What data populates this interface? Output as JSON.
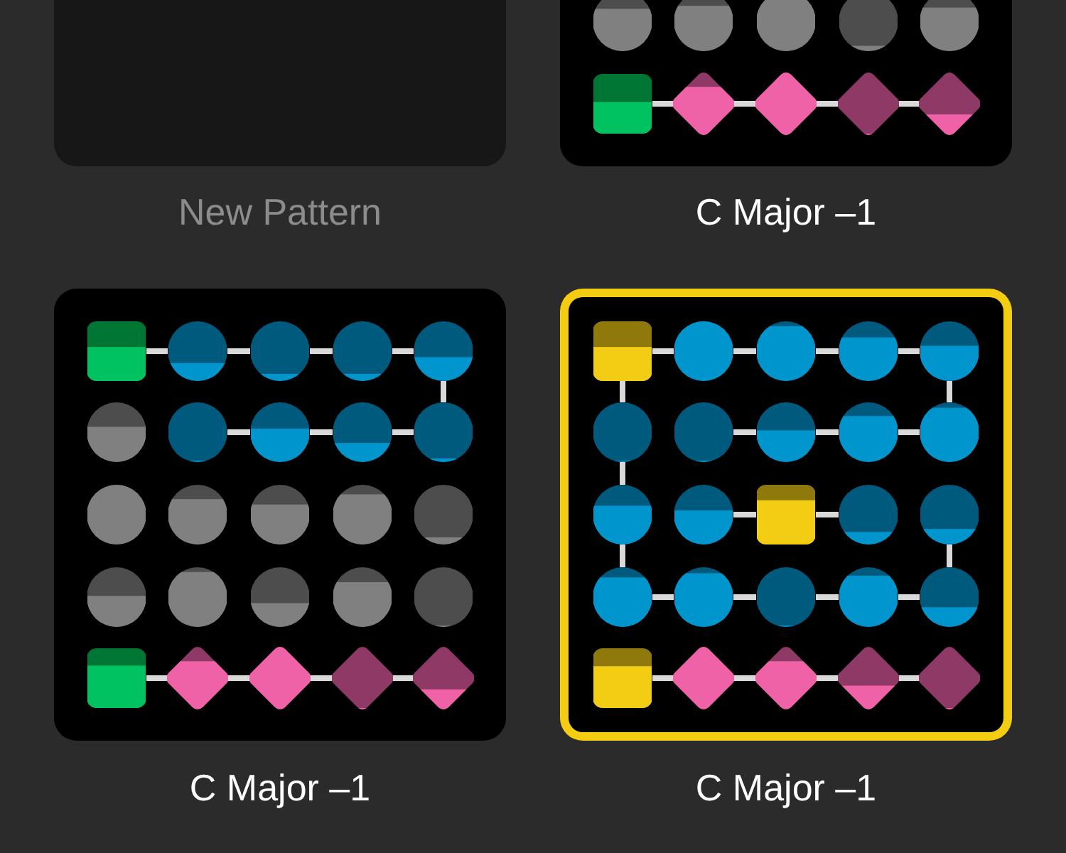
{
  "patterns": [
    {
      "kind": "new",
      "title": "New Pattern",
      "selected": false
    },
    {
      "kind": "pattern",
      "title": "C Major –1",
      "selected": false,
      "rows": [
        {
          "nodes": [
            {
              "kind": "circle",
              "active": false,
              "level": 0.71,
              "link_right": false,
              "link_down": false
            },
            {
              "kind": "circle",
              "active": false,
              "level": 0.76,
              "link_right": false,
              "link_down": false
            },
            {
              "kind": "circle",
              "active": false,
              "level": 0.86,
              "link_right": false,
              "link_down": false
            },
            {
              "kind": "circle",
              "active": false,
              "level": 0.09,
              "link_right": false,
              "link_down": false
            },
            {
              "kind": "circle",
              "active": false,
              "level": 0.73,
              "link_right": false,
              "link_down": false
            }
          ]
        },
        {
          "nodes": [
            {
              "kind": "square",
              "level": 0.53,
              "link_right": true,
              "link_down": false
            },
            {
              "kind": "diamond",
              "level": 0.77,
              "link_right": true,
              "link_down": false
            },
            {
              "kind": "diamond",
              "level": 1,
              "link_right": true,
              "link_down": false
            },
            {
              "kind": "diamond",
              "level": 0,
              "link_right": true,
              "link_down": false
            },
            {
              "kind": "diamond",
              "level": 0.33,
              "link_right": false,
              "link_down": false
            }
          ]
        }
      ]
    },
    {
      "kind": "pattern",
      "title": "C Major –1",
      "selected": false,
      "rows": [
        {
          "nodes": [
            {
              "kind": "square",
              "level": 0.57,
              "link_right": true,
              "link_down": false
            },
            {
              "kind": "circle",
              "active": true,
              "level": 0.3,
              "link_right": true,
              "link_down": false
            },
            {
              "kind": "circle",
              "active": true,
              "level": 0.12,
              "link_right": true,
              "link_down": false
            },
            {
              "kind": "circle",
              "active": true,
              "level": 0.12,
              "link_right": true,
              "link_down": false
            },
            {
              "kind": "circle",
              "active": true,
              "level": 0.4,
              "link_right": false,
              "link_down": true
            }
          ]
        },
        {
          "nodes": [
            {
              "kind": "circle",
              "active": false,
              "level": 0.59,
              "link_right": false,
              "link_down": false
            },
            {
              "kind": "circle",
              "active": true,
              "level": 0,
              "link_right": true,
              "link_down": false
            },
            {
              "kind": "circle",
              "active": true,
              "level": 0.56,
              "link_right": true,
              "link_down": false
            },
            {
              "kind": "circle",
              "active": true,
              "level": 0.32,
              "link_right": true,
              "link_down": false
            },
            {
              "kind": "circle",
              "active": true,
              "level": 0.06,
              "link_right": false,
              "link_down": false
            }
          ]
        },
        {
          "nodes": [
            {
              "kind": "circle",
              "active": false,
              "level": 1,
              "link_right": false,
              "link_down": false
            },
            {
              "kind": "circle",
              "active": false,
              "level": 0.76,
              "link_right": false,
              "link_down": false
            },
            {
              "kind": "circle",
              "active": false,
              "level": 0.67,
              "link_right": false,
              "link_down": false
            },
            {
              "kind": "circle",
              "active": false,
              "level": 0.84,
              "link_right": false,
              "link_down": false
            },
            {
              "kind": "circle",
              "active": false,
              "level": 0.12,
              "link_right": false,
              "link_down": false
            }
          ]
        },
        {
          "nodes": [
            {
              "kind": "circle",
              "active": false,
              "level": 0.52,
              "link_right": false,
              "link_down": false
            },
            {
              "kind": "circle",
              "active": false,
              "level": 0.92,
              "link_right": false,
              "link_down": false
            },
            {
              "kind": "circle",
              "active": false,
              "level": 0.4,
              "link_right": false,
              "link_down": false
            },
            {
              "kind": "circle",
              "active": false,
              "level": 0.75,
              "link_right": false,
              "link_down": false
            },
            {
              "kind": "circle",
              "active": false,
              "level": 0,
              "link_right": false,
              "link_down": false
            }
          ]
        },
        {
          "nodes": [
            {
              "kind": "square",
              "level": 0.71,
              "link_right": true,
              "link_down": false
            },
            {
              "kind": "diamond",
              "level": 0.77,
              "link_right": true,
              "link_down": false
            },
            {
              "kind": "diamond",
              "level": 1,
              "link_right": true,
              "link_down": false
            },
            {
              "kind": "diamond",
              "level": 0,
              "link_right": true,
              "link_down": false
            },
            {
              "kind": "diamond",
              "level": 0.32,
              "link_right": false,
              "link_down": false
            }
          ]
        }
      ]
    },
    {
      "kind": "pattern",
      "title": "C Major –1",
      "selected": true,
      "rows": [
        {
          "nodes": [
            {
              "kind": "square",
              "level": 0.57,
              "link_right": true,
              "link_down": true
            },
            {
              "kind": "circle",
              "active": true,
              "level": 1,
              "link_right": true,
              "link_down": false
            },
            {
              "kind": "circle",
              "active": true,
              "level": 0.92,
              "link_right": true,
              "link_down": false
            },
            {
              "kind": "circle",
              "active": true,
              "level": 0.73,
              "link_right": true,
              "link_down": false
            },
            {
              "kind": "circle",
              "active": true,
              "level": 0.59,
              "link_right": false,
              "link_down": true
            }
          ]
        },
        {
          "nodes": [
            {
              "kind": "circle",
              "active": true,
              "level": 0,
              "link_right": false,
              "link_down": true
            },
            {
              "kind": "circle",
              "active": true,
              "level": 0,
              "link_right": true,
              "link_down": false
            },
            {
              "kind": "circle",
              "active": true,
              "level": 0.53,
              "link_right": true,
              "link_down": false
            },
            {
              "kind": "circle",
              "active": true,
              "level": 0.77,
              "link_right": true,
              "link_down": false
            },
            {
              "kind": "circle",
              "active": true,
              "level": 0.91,
              "link_right": false,
              "link_down": false
            }
          ]
        },
        {
          "nodes": [
            {
              "kind": "circle",
              "active": true,
              "level": 0.65,
              "link_right": false,
              "link_down": true
            },
            {
              "kind": "circle",
              "active": true,
              "level": 0.57,
              "link_right": true,
              "link_down": false
            },
            {
              "kind": "square",
              "level": 0.74,
              "link_right": true,
              "link_down": false
            },
            {
              "kind": "circle",
              "active": true,
              "level": 0.21,
              "link_right": false,
              "link_down": false
            },
            {
              "kind": "circle",
              "active": true,
              "level": 0.26,
              "link_right": false,
              "link_down": true
            }
          ]
        },
        {
          "nodes": [
            {
              "kind": "circle",
              "active": true,
              "level": 0.83,
              "link_right": true,
              "link_down": false
            },
            {
              "kind": "circle",
              "active": true,
              "level": 0.9,
              "link_right": true,
              "link_down": false
            },
            {
              "kind": "circle",
              "active": true,
              "level": 0,
              "link_right": true,
              "link_down": false
            },
            {
              "kind": "circle",
              "active": true,
              "level": 0.86,
              "link_right": true,
              "link_down": false
            },
            {
              "kind": "circle",
              "active": true,
              "level": 0.33,
              "link_right": false,
              "link_down": false
            }
          ]
        },
        {
          "nodes": [
            {
              "kind": "square",
              "level": 0.7,
              "link_right": true,
              "link_down": false
            },
            {
              "kind": "diamond",
              "level": 1,
              "link_right": true,
              "link_down": false
            },
            {
              "kind": "diamond",
              "level": 0.77,
              "link_right": true,
              "link_down": false
            },
            {
              "kind": "diamond",
              "level": 0.38,
              "link_right": true,
              "link_down": false
            },
            {
              "kind": "diamond",
              "level": 0,
              "link_right": false,
              "link_down": false
            }
          ]
        }
      ]
    }
  ]
}
